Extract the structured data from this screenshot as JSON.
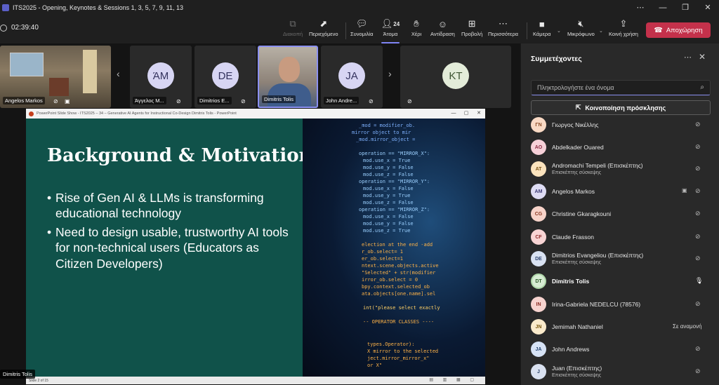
{
  "window": {
    "title": "ITS2025 - Opening, Keynotes & Sessions 1, 3, 5, 7, 9, 11, 13",
    "controls": [
      "⋯",
      "—",
      "❐",
      "✕"
    ]
  },
  "toolbar": {
    "timer": "02:39:40",
    "buttons": {
      "share_screen": "Διακοπή",
      "content": "Περιεχόμενο",
      "chat": "Συνομιλία",
      "people": "Άτομα",
      "people_count": "24",
      "raise_hand": "Χέρι",
      "react": "Αντίδραση",
      "view": "Προβολή",
      "more": "Περισσότερα",
      "camera": "Κάμερα",
      "mic": "Μικρόφωνο",
      "share": "Κοινή χρήση",
      "leave": "Αποχώρηση"
    }
  },
  "gallery": [
    {
      "name": "Angelos Markos",
      "type": "video"
    },
    {
      "name": "Άγγελος Μ...",
      "initials": "ΆΜ",
      "type": "avatar"
    },
    {
      "name": "Dimitrios E...",
      "initials": "DE",
      "type": "avatar"
    },
    {
      "name": "Dimitris Tolis",
      "type": "video"
    },
    {
      "name": "John Andre...",
      "initials": "JA",
      "type": "avatar"
    },
    {
      "name": "",
      "initials": "KT",
      "type": "avatar"
    }
  ],
  "ppt": {
    "window_title": "PowerPoint Slide Show  -  ITS2025 – 34 – Generative AI Agents for Instructional Co-Design Dimitris Tolis  -  PowerPoint",
    "status": "Slide 2 of 15",
    "slide": {
      "heading": "Background & Motivation",
      "bullets": [
        "Rise of Gen AI & LLMs is transforming educational technology",
        "Need to design usable, trustworthy AI tools for non-technical users (Educators as Citizen Developers)"
      ]
    }
  },
  "sharer_label": "Dimitris Tolis",
  "panel": {
    "title": "Συμμετέχοντες",
    "search_placeholder": "Πληκτρολογήστε ένα όνομα",
    "share_invite": "Κοινοποίηση πρόσκλησης",
    "participants": [
      {
        "initials": "ΓΝ",
        "name": "Γιωργος Νικέλλης",
        "sub": "",
        "status": "muted"
      },
      {
        "initials": "AO",
        "name": "Abdelkader Ouared",
        "sub": "",
        "status": "muted"
      },
      {
        "initials": "AT",
        "name": "Andromachi Tempeli (Επισκέπτης)",
        "sub": "Επισκέπτης σύσκεψης",
        "status": "muted"
      },
      {
        "initials": "AM",
        "name": "Angelos Markos",
        "sub": "",
        "status": "muted"
      },
      {
        "initials": "CG",
        "name": "Christine Gkaragkouni",
        "sub": "",
        "status": "muted"
      },
      {
        "initials": "CF",
        "name": "Claude Frasson",
        "sub": "",
        "status": "muted"
      },
      {
        "initials": "DE",
        "name": "Dimitrios Evangeliou (Επισκέπτης)",
        "sub": "Επισκέπτης σύσκεψης",
        "status": "muted"
      },
      {
        "initials": "DT",
        "name": "Dimitris Tolis",
        "sub": "",
        "status": "speaking"
      },
      {
        "initials": "IN",
        "name": "Irina-Gabriela NEDELCU (78576)",
        "sub": "",
        "status": "muted"
      },
      {
        "initials": "JN",
        "name": "Jemimah Nathaniel",
        "sub": "",
        "status": "Σε αναμονή"
      },
      {
        "initials": "JA",
        "name": "John Andrews",
        "sub": "",
        "status": "muted"
      },
      {
        "initials": "J",
        "name": "Juan (Επισκέπτης)",
        "sub": "Επισκέπτης σύσκεψης",
        "status": "muted"
      }
    ]
  }
}
